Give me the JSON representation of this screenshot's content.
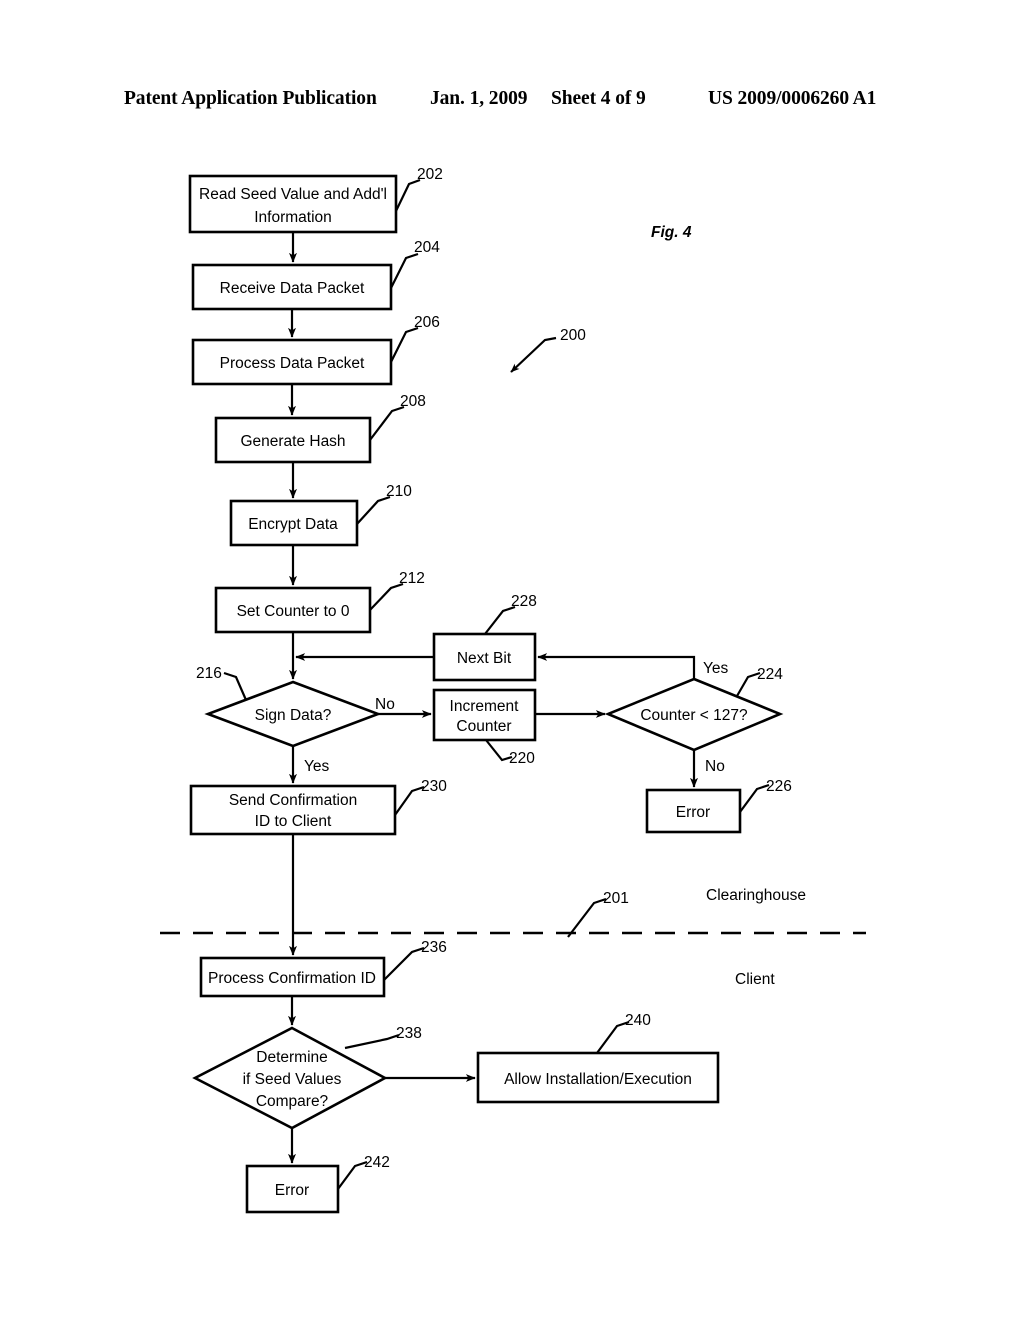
{
  "header": {
    "publication": "Patent Application Publication",
    "date": "Jan. 1, 2009",
    "sheet": "Sheet 4 of 9",
    "patent_number": "US 2009/0006260 A1"
  },
  "figure": {
    "label": "Fig. 4",
    "diagram_ref": "200",
    "divider_ref": "201"
  },
  "zones": {
    "top": "Clearinghouse",
    "bottom": "Client"
  },
  "nodes": [
    {
      "id": "n202",
      "ref": "202",
      "shape": "process",
      "lines": [
        "Read Seed Value and Add'l",
        "Information"
      ]
    },
    {
      "id": "n204",
      "ref": "204",
      "shape": "process",
      "lines": [
        "Receive Data Packet"
      ]
    },
    {
      "id": "n206",
      "ref": "206",
      "shape": "process",
      "lines": [
        "Process Data Packet"
      ]
    },
    {
      "id": "n208",
      "ref": "208",
      "shape": "process",
      "lines": [
        "Generate Hash"
      ]
    },
    {
      "id": "n210",
      "ref": "210",
      "shape": "process",
      "lines": [
        "Encrypt Data"
      ]
    },
    {
      "id": "n212",
      "ref": "212",
      "shape": "process",
      "lines": [
        "Set Counter to 0"
      ]
    },
    {
      "id": "n216",
      "ref": "216",
      "shape": "decision",
      "lines": [
        "Sign Data?"
      ]
    },
    {
      "id": "n228",
      "ref": "228",
      "shape": "process",
      "lines": [
        "Next Bit"
      ]
    },
    {
      "id": "n220",
      "ref": "220",
      "shape": "process",
      "lines": [
        "Increment",
        "Counter"
      ]
    },
    {
      "id": "n224",
      "ref": "224",
      "shape": "decision",
      "lines": [
        "Counter < 127?"
      ]
    },
    {
      "id": "n226",
      "ref": "226",
      "shape": "process",
      "lines": [
        "Error"
      ]
    },
    {
      "id": "n230",
      "ref": "230",
      "shape": "process",
      "lines": [
        "Send Confirmation",
        "ID to Client"
      ]
    },
    {
      "id": "n236",
      "ref": "236",
      "shape": "process",
      "lines": [
        "Process Confirmation ID"
      ]
    },
    {
      "id": "n238",
      "ref": "238",
      "shape": "decision",
      "lines": [
        "Determine",
        "if Seed Values",
        "Compare?"
      ]
    },
    {
      "id": "n240",
      "ref": "240",
      "shape": "process",
      "lines": [
        "Allow Installation/Execution"
      ]
    },
    {
      "id": "n242",
      "ref": "242",
      "shape": "process",
      "lines": [
        "Error"
      ]
    }
  ],
  "edge_labels": {
    "sign_data_no": "No",
    "sign_data_yes": "Yes",
    "counter_yes": "Yes",
    "counter_no": "No"
  }
}
